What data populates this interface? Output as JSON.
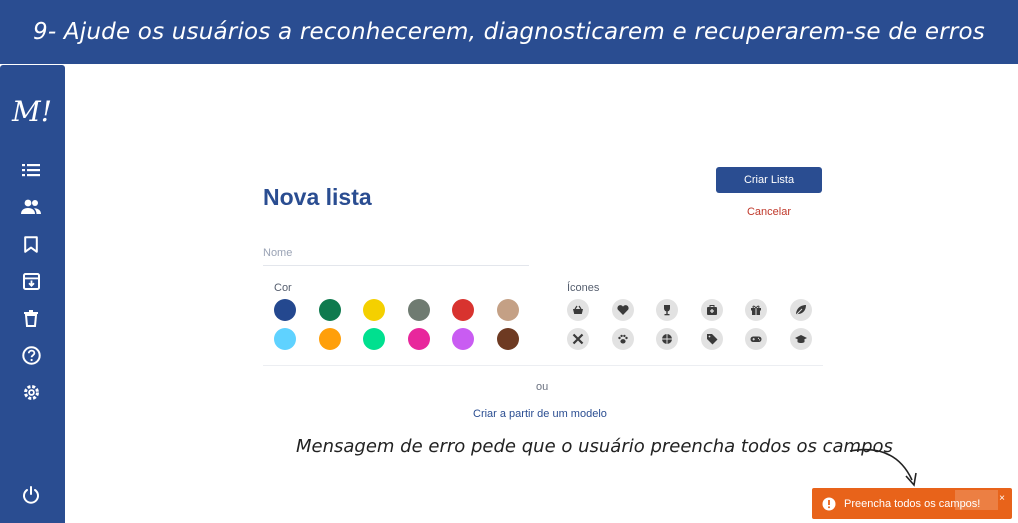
{
  "banner": {
    "title": "9- Ajude os usuários a reconhecerem, diagnosticarem e recuperarem-se de erros"
  },
  "sidebar": {
    "logo": "M!",
    "items": [
      {
        "icon": "list-icon"
      },
      {
        "icon": "people-icon"
      },
      {
        "icon": "bookmark-icon"
      },
      {
        "icon": "archive-icon"
      },
      {
        "icon": "trash-icon"
      },
      {
        "icon": "help-icon"
      },
      {
        "icon": "gear-icon"
      },
      {
        "icon": "power-icon"
      }
    ]
  },
  "form": {
    "title": "Nova lista",
    "create_label": "Criar Lista",
    "cancel_label": "Cancelar",
    "name_placeholder": "Nome",
    "name_value": "",
    "color_label": "Cor",
    "colors": [
      "#24488f",
      "#0e7a4e",
      "#f4d000",
      "#6f7b71",
      "#d8332f",
      "#c4a085",
      "#5fd2ff",
      "#ff9f0a",
      "#00e08f",
      "#e8279c",
      "#c95cf2",
      "#6e3a22"
    ],
    "icons_label": "Ícones",
    "icons": [
      "basket-icon",
      "heart-icon",
      "trophy-icon",
      "first-aid-icon",
      "gift-icon",
      "leaf-icon",
      "tools-icon",
      "paw-icon",
      "ball-icon",
      "tag-icon",
      "gamepad-icon",
      "graduation-cap-icon"
    ],
    "or_label": "ou",
    "template_link": "Criar a partir de um modelo"
  },
  "annotation": {
    "text": "Mensagem de erro pede que o usuário preencha todos os campos"
  },
  "toast": {
    "message": "Preencha todos os campos!",
    "close": "×",
    "color": "#e8631a"
  }
}
